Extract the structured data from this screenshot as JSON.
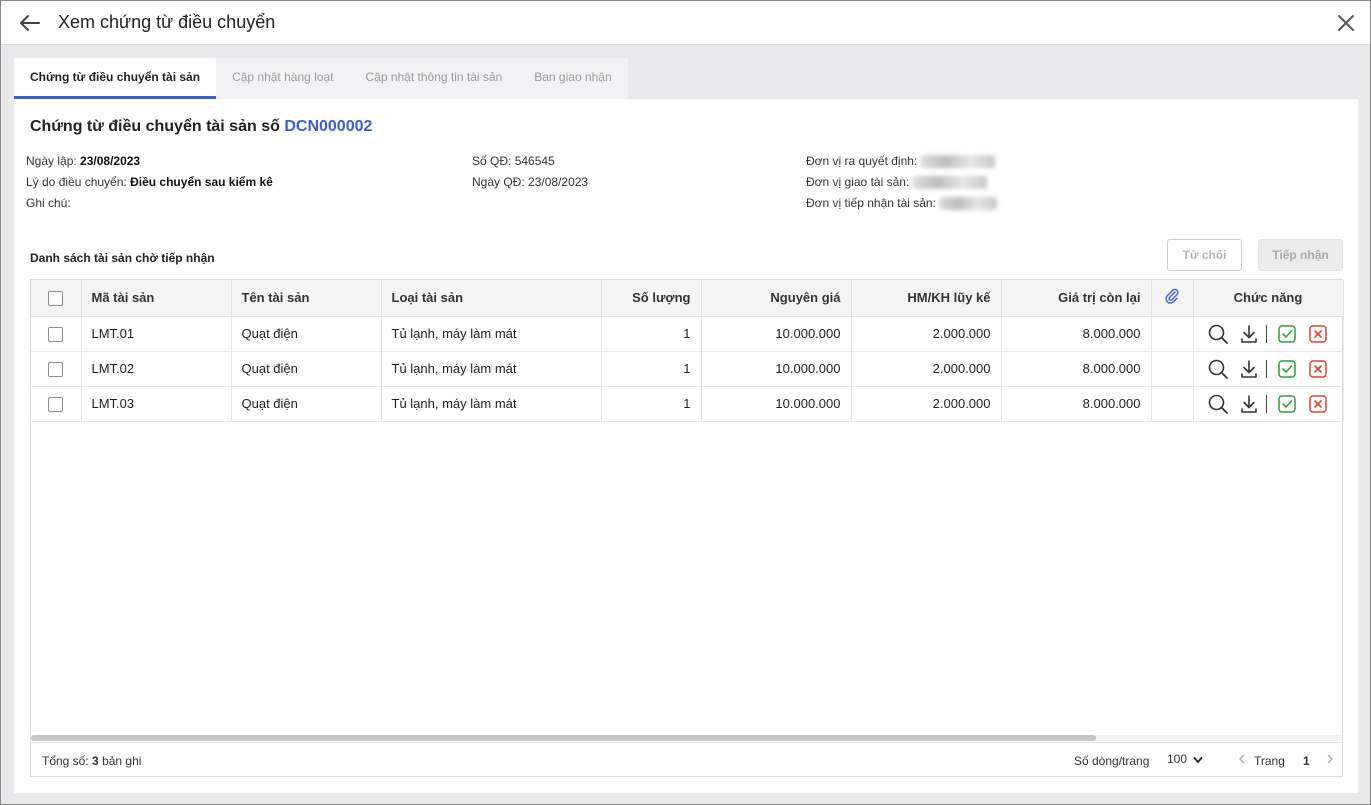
{
  "header": {
    "title": "Xem chứng từ điều chuyển"
  },
  "tabs": [
    {
      "label": "Chứng từ điều chuyển tài sản"
    },
    {
      "label": "Cập nhật hàng loạt"
    },
    {
      "label": "Cập nhật thông tin tài sản"
    },
    {
      "label": "Ban giao nhận"
    }
  ],
  "document": {
    "title_prefix": "Chứng từ điều chuyển tài sản số",
    "code": "DCN000002",
    "ngay_lap_label": "Ngày lập:",
    "ngay_lap": "23/08/2023",
    "ly_do_label": "Lý do điều chuyển:",
    "ly_do": "Điều chuyển sau kiểm kê",
    "ghi_chu_label": "Ghi chú:",
    "so_qd_label": "Số QĐ:",
    "so_qd": "546545",
    "ngay_qd_label": "Ngày QĐ:",
    "ngay_qd": "23/08/2023",
    "don_vi_ra_qd_label": "Đơn vị ra quyết định:",
    "don_vi_giao_label": "Đơn vị giao tài sản:",
    "don_vi_nhan_label": "Đơn vị tiếp nhận tài sản:"
  },
  "list": {
    "title": "Danh sách tài sản chờ tiếp nhận",
    "reject_label": "Từ chối",
    "accept_label": "Tiếp nhận"
  },
  "table": {
    "headers": {
      "ma": "Mã tài sản",
      "ten": "Tên tài sản",
      "loai": "Loại tài sản",
      "so_luong": "Số lượng",
      "nguyen_gia": "Nguyên giá",
      "hm": "HM/KH lũy kế",
      "gia_tri": "Giá trị còn lại",
      "chuc_nang": "Chức năng"
    },
    "rows": [
      {
        "ma": "LMT.01",
        "ten": "Quạt điện",
        "loai": "Tủ lạnh, máy làm mát",
        "so_luong": "1",
        "nguyen_gia": "10.000.000",
        "hm": "2.000.000",
        "gia_tri": "8.000.000"
      },
      {
        "ma": "LMT.02",
        "ten": "Quạt điện",
        "loai": "Tủ lạnh, máy làm mát",
        "so_luong": "1",
        "nguyen_gia": "10.000.000",
        "hm": "2.000.000",
        "gia_tri": "8.000.000"
      },
      {
        "ma": "LMT.03",
        "ten": "Quạt điện",
        "loai": "Tủ lạnh, máy làm mát",
        "so_luong": "1",
        "nguyen_gia": "10.000.000",
        "hm": "2.000.000",
        "gia_tri": "8.000.000"
      }
    ]
  },
  "footer": {
    "total_prefix": "Tổng số:",
    "total_count": "3",
    "total_suffix": "bản ghi",
    "rows_per_page_label": "Số dòng/trang",
    "rows_per_page": "100",
    "page_label": "Trang",
    "page": "1"
  },
  "colors": {
    "accent": "#3b5fd0",
    "approve": "#2e9e3e",
    "reject": "#e0402c"
  },
  "icons": [
    "back-arrow-icon",
    "close-icon",
    "paperclip-icon",
    "search-icon",
    "download-icon",
    "approve-check-icon",
    "reject-x-icon",
    "chevron-down-icon",
    "chevron-left-icon",
    "chevron-right-icon"
  ]
}
